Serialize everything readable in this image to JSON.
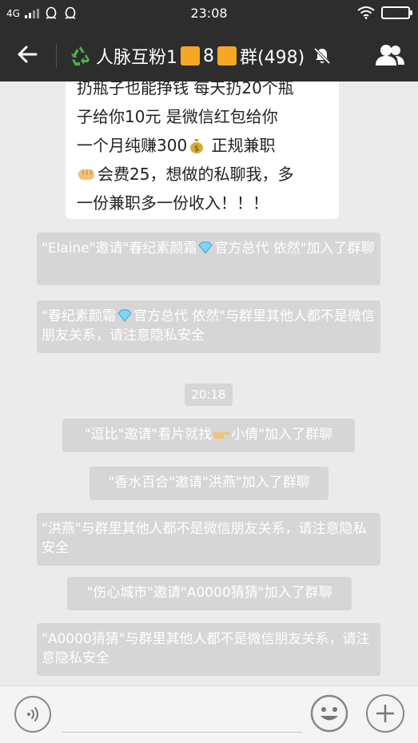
{
  "status_bar": {
    "network": "4G",
    "time": "23:08"
  },
  "header": {
    "title_part1": "人脉互粉1",
    "title_part2": "8",
    "title_part3": "群(498)",
    "icons": [
      "back-arrow-icon",
      "recycle-icon",
      "mute-icon",
      "group-members-icon"
    ]
  },
  "message": {
    "lines": [
      "扔瓶子也能挣钱 每天扔20个瓶",
      "子给你10元 是微信红包给你",
      "一个月纯赚300",
      " 正规兼职",
      "会费25，想做的私聊我，多",
      "一份兼职多一份收入！！！"
    ]
  },
  "system_messages": [
    {
      "pre": "\"Elaine\"邀请\"春纪素颜霜",
      "post": "官方总代 依然\"加入了群聊"
    },
    {
      "pre": "\"春纪素颜霜",
      "post": "官方总代 依然\"与群里其他人都不是微信朋友关系，请注意隐私安全"
    },
    {
      "pre": "\"逗比\"邀请\"看片就找",
      "post": "小倩\"加入了群聊"
    },
    {
      "text": "\"香水百合\"邀请\"洪燕\"加入了群聊"
    },
    {
      "text": "\"洪燕\"与群里其他人都不是微信朋友关系，请注意隐私安全"
    },
    {
      "text": "\"伤心城市\"邀请\"A0000猜猜\"加入了群聊"
    },
    {
      "text": "\"A0000猜猜\"与群里其他人都不是微信朋友关系，请注意隐私安全"
    }
  ],
  "timestamp": "20:18",
  "input": {
    "placeholder": ""
  },
  "colors": {
    "header_bg": "#2d2d2d",
    "chat_bg": "#ebebeb",
    "system_bubble": "#d6d6d6",
    "accent_square": "#f5a623"
  }
}
